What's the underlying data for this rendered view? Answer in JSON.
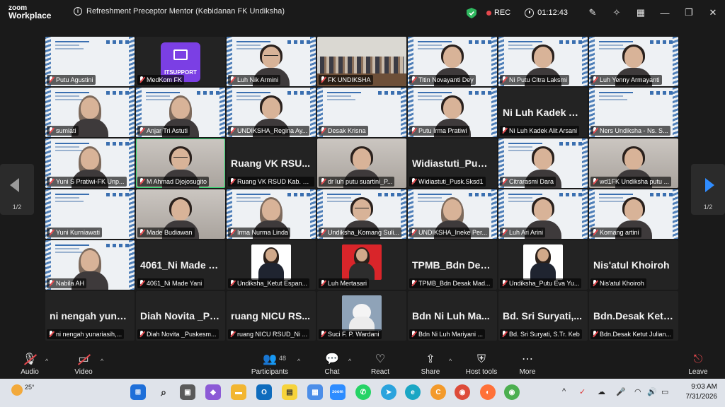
{
  "app": {
    "brand_line1": "zoom",
    "brand_line2": "Workplace"
  },
  "meeting": {
    "title": "Refreshment Preceptor Mentor (Kebidanan FK Undiksha)",
    "rec_label": "REC",
    "timer": "01:12:43"
  },
  "pager": {
    "left_page": "1/2",
    "right_page": "1/2"
  },
  "itsupport_label": "ITSUPPORT",
  "tiles": [
    {
      "kind": "pres",
      "name": "Putu Agustini"
    },
    {
      "kind": "itsupport",
      "name": "MedKom FK"
    },
    {
      "kind": "pres",
      "name": "Luh Nik Armini",
      "person": "glasses"
    },
    {
      "kind": "room",
      "name": "FK UNDIKSHA"
    },
    {
      "kind": "pres",
      "name": "Titin Novayanti Dey",
      "person": "plain"
    },
    {
      "kind": "pres",
      "name": "Ni Putu Citra Laksmi",
      "person": "plain"
    },
    {
      "kind": "pres",
      "name": "Luh Yenny Armayanti",
      "person": "plain"
    },
    {
      "kind": "pres",
      "name": "sumiati",
      "person": "hijab"
    },
    {
      "kind": "pres",
      "name": "Anjar Tri Astuti",
      "person": "hijab"
    },
    {
      "kind": "pres",
      "name": "UNDIKSHA_Regina Ay...",
      "person": "plain"
    },
    {
      "kind": "pres",
      "name": "Desak Krisna"
    },
    {
      "kind": "pres",
      "name": "Putu Irma Pratiwi",
      "person": "plain"
    },
    {
      "kind": "dark",
      "name": "Ni Luh Kadek Alit Arsani",
      "big": "Ni Luh Kadek Al..."
    },
    {
      "kind": "pres",
      "name": "Ners Undiksha - Ns. S..."
    },
    {
      "kind": "pres",
      "name": "Yuni S Pratiwi-FK Unp...",
      "person": "hijab"
    },
    {
      "kind": "cam",
      "name": "M Ahmad Djojosugito",
      "person": "glasses",
      "active": true
    },
    {
      "kind": "dark",
      "name": "Ruang VK RSUD Kab. B...",
      "big": "Ruang VK RSU..."
    },
    {
      "kind": "cam",
      "name": "dr luh putu suartini_P...",
      "person": "plain"
    },
    {
      "kind": "dark",
      "name": "Widiastuti_Pusk.Sksd1",
      "big": "Widiastuti_Pusk..."
    },
    {
      "kind": "pres",
      "name": "Citrarasmi Dara",
      "person": "plain"
    },
    {
      "kind": "cam",
      "name": "wd1FK Undiksha putu ...",
      "person": "plain"
    },
    {
      "kind": "pres",
      "name": "Yuni Kurniawati"
    },
    {
      "kind": "cam",
      "name": "Made Budiawan",
      "person": "plain"
    },
    {
      "kind": "pres",
      "name": "Irma Nurma Linda",
      "person": "hijab"
    },
    {
      "kind": "pres",
      "name": "Undiksha_Komang Suli...",
      "person": "glasses"
    },
    {
      "kind": "pres",
      "name": "UNDIKSHA_Ineke Per...",
      "person": "hijab"
    },
    {
      "kind": "pres",
      "name": "Luh Ari Arini",
      "person": "plain"
    },
    {
      "kind": "pres",
      "name": "Komang  artini",
      "person": "plain"
    },
    {
      "kind": "pres",
      "name": "Nabila AH",
      "person": "hijab"
    },
    {
      "kind": "dark",
      "name": "4061_Ni Made Yani",
      "big": "4061_Ni Made Y..."
    },
    {
      "kind": "photo",
      "name": "Undiksha_Ketut Espan...",
      "photo": "white"
    },
    {
      "kind": "photo",
      "name": "Luh Mertasari",
      "photo": "red"
    },
    {
      "kind": "dark",
      "name": "TPMB_Bdn Desak Mad...",
      "big": "TPMB_Bdn  Des..."
    },
    {
      "kind": "photo",
      "name": "Undiksha_Putu Eva Yu...",
      "photo": "white"
    },
    {
      "kind": "dark",
      "name": "Nis'atul Khoiroh",
      "big": "Nis'atul Khoiroh"
    },
    {
      "kind": "dark",
      "name": "ni nengah yunariasih,...",
      "big": "ni nengah yuna..."
    },
    {
      "kind": "dark",
      "name": "Diah Novita _Puskesm...",
      "big": "Diah Novita _Pu..."
    },
    {
      "kind": "dark",
      "name": "ruang NICU RSUD_Ni ...",
      "big": "ruang NICU RS..."
    },
    {
      "kind": "photo",
      "name": "Suci F. P. Wardani",
      "photo": "cat"
    },
    {
      "kind": "dark",
      "name": "Bdn  Ni Luh Mariyani ...",
      "big": "Bdn  Ni Luh Ma..."
    },
    {
      "kind": "dark",
      "name": "Bd. Sri Suryati, S.Tr. Keb",
      "big": "Bd. Sri Suryati,..."
    },
    {
      "kind": "dark",
      "name": "Bdn.Desak Ketut Julian...",
      "big": "Bdn.Desak  Ketu..."
    }
  ],
  "toolbar": {
    "audio": "Audio",
    "video": "Video",
    "participants": "Participants",
    "participants_count": "48",
    "chat": "Chat",
    "react": "React",
    "share": "Share",
    "host_tools": "Host tools",
    "more": "More",
    "leave": "Leave"
  },
  "taskbar": {
    "temp": "25°",
    "time": "9:03 AM",
    "date": "7/31/2026",
    "search_icon": "search-icon"
  },
  "colors": {
    "accent": "#2f8cff",
    "rec": "#e5484d",
    "active_speaker": "#2fd86f",
    "itsupport": "#7b3fe4"
  }
}
